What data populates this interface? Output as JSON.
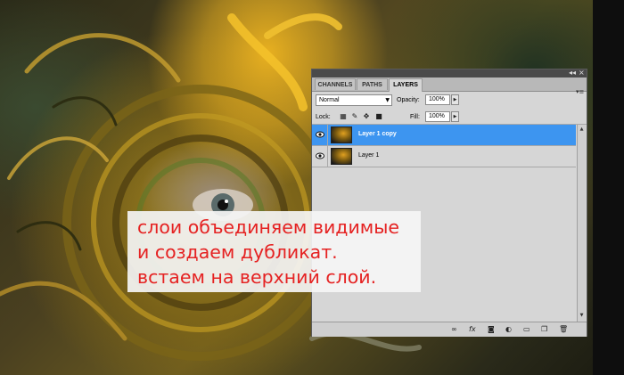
{
  "background": {
    "description_icon": "fractal-portrait-artwork"
  },
  "layers_panel": {
    "tabs": [
      {
        "label": "CHANNELS",
        "active": false
      },
      {
        "label": "PATHS",
        "active": false
      },
      {
        "label": "LAYERS",
        "active": true
      }
    ],
    "blend_mode": "Normal",
    "opacity_label": "Opacity:",
    "opacity_value": "100%",
    "lock_label": "Lock:",
    "fill_label": "Fill:",
    "fill_value": "100%",
    "layers": [
      {
        "name": "Layer 1 copy",
        "selected": true,
        "visible": true
      },
      {
        "name": "Layer 1",
        "selected": false,
        "visible": true
      }
    ],
    "selection_color": "#3d95f0"
  },
  "instruction_note": {
    "lines": [
      "слои объединяем видимые",
      "и создаем дубликат.",
      "встаем на верхний слой."
    ],
    "text_color": "#e52222"
  }
}
